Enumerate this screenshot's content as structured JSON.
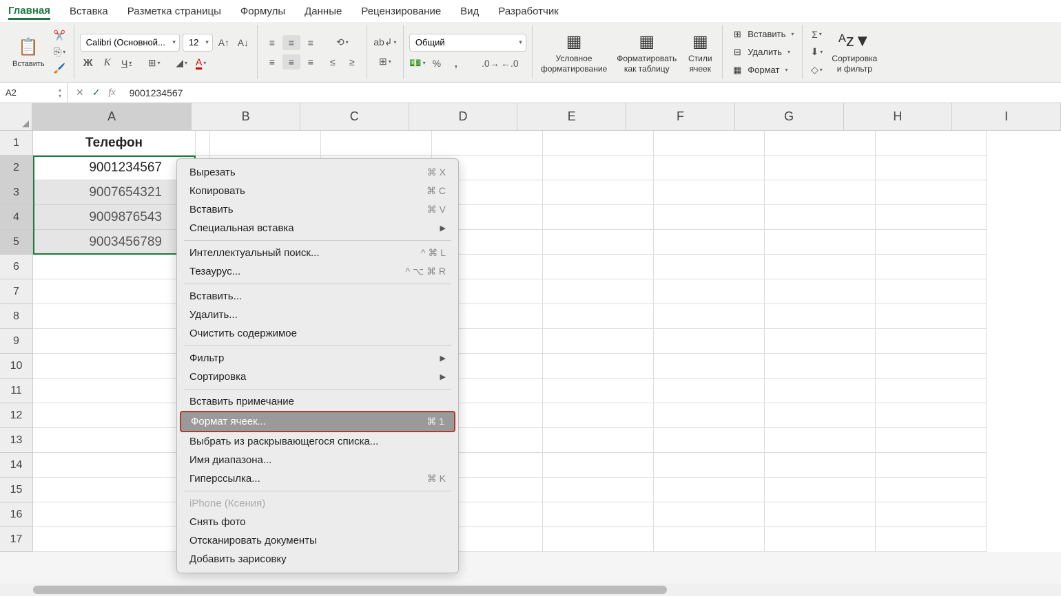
{
  "tabs": [
    "Главная",
    "Вставка",
    "Разметка страницы",
    "Формулы",
    "Данные",
    "Рецензирование",
    "Вид",
    "Разработчик"
  ],
  "ribbon": {
    "paste": "Вставить",
    "font_name": "Calibri (Основной...",
    "font_size": "12",
    "number_format": "Общий",
    "cond_format": "Условное\nформатирование",
    "format_table": "Форматировать\nкак таблицу",
    "cell_styles": "Стили\nячеек",
    "insert": "Вставить",
    "delete": "Удалить",
    "format": "Формат",
    "sort_filter": "Сортировка\nи фильтр"
  },
  "formula_bar": {
    "cell_ref": "A2",
    "formula": "9001234567"
  },
  "columns": [
    "A",
    "B",
    "C",
    "D",
    "E",
    "F",
    "G",
    "H",
    "I"
  ],
  "rows": [
    "1",
    "2",
    "3",
    "4",
    "5",
    "6",
    "7",
    "8",
    "9",
    "10",
    "11",
    "12",
    "13",
    "14",
    "15",
    "16",
    "17"
  ],
  "data": {
    "header": "Телефон",
    "values": [
      "9001234567",
      "9007654321",
      "9009876543",
      "9003456789"
    ]
  },
  "context_menu": {
    "cut": "Вырезать",
    "cut_key": "⌘ X",
    "copy": "Копировать",
    "copy_key": "⌘ C",
    "paste": "Вставить",
    "paste_key": "⌘ V",
    "paste_special": "Специальная вставка",
    "smart_lookup": "Интеллектуальный поиск...",
    "smart_key": "^ ⌘ L",
    "thesaurus": "Тезаурус...",
    "thesaurus_key": "^ ⌥ ⌘ R",
    "insert": "Вставить...",
    "delete": "Удалить...",
    "clear": "Очистить содержимое",
    "filter": "Фильтр",
    "sort": "Сортировка",
    "add_comment": "Вставить примечание",
    "format_cells": "Формат ячеек...",
    "format_key": "⌘ 1",
    "dropdown_pick": "Выбрать из раскрывающегося списка...",
    "range_name": "Имя диапазона...",
    "hyperlink": "Гиперссылка...",
    "hyperlink_key": "⌘ K",
    "iphone": "iPhone (Ксения)",
    "photo": "Снять фото",
    "scan": "Отсканировать документы",
    "sketch": "Добавить зарисовку"
  }
}
